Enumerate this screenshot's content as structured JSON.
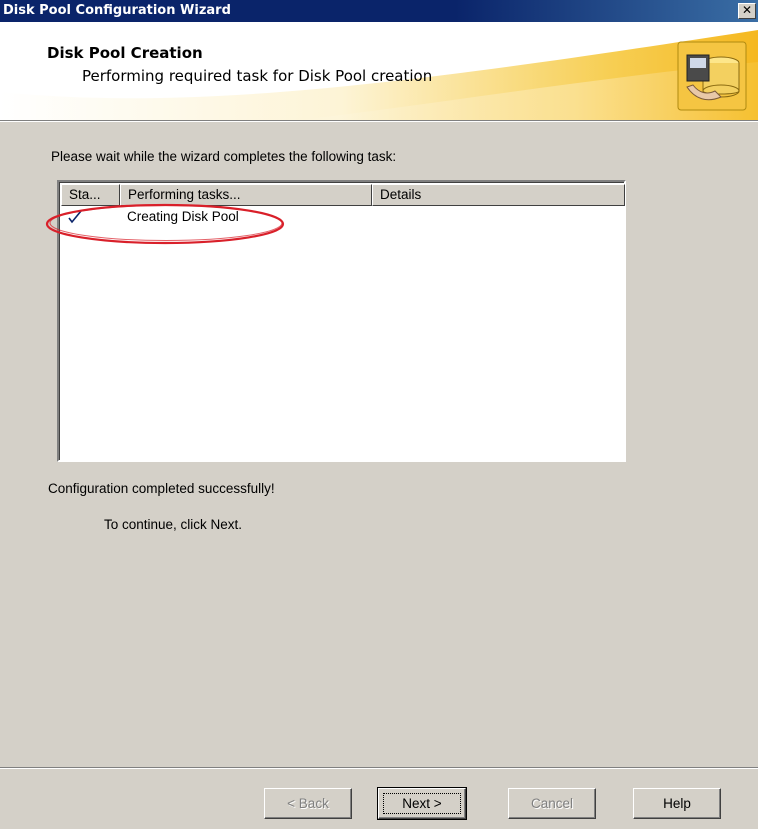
{
  "window": {
    "title": "Disk Pool Configuration Wizard",
    "close_label": "✕"
  },
  "header": {
    "title": "Disk Pool Creation",
    "subtitle": "Performing required task for Disk Pool creation",
    "icon": "disk-pool-wizard-icon"
  },
  "main": {
    "instruction": "Please wait while the wizard completes the following task:",
    "table": {
      "columns": [
        "Sta...",
        "Performing tasks...",
        "Details"
      ],
      "rows": [
        {
          "status_icon": "check-icon",
          "task": "Creating Disk Pool",
          "details": ""
        }
      ]
    },
    "status_message": "Configuration completed successfully!",
    "continue_message": "To continue, click Next."
  },
  "footer": {
    "back_label": "< Back",
    "next_label": "Next >",
    "cancel_label": "Cancel",
    "help_label": "Help"
  },
  "colors": {
    "titlebar": "#0a246a",
    "dialog_bg": "#d4d0c8",
    "header_swoosh": "#f5c542",
    "annotation_oval": "#d9202a",
    "check": "#0a246a"
  }
}
